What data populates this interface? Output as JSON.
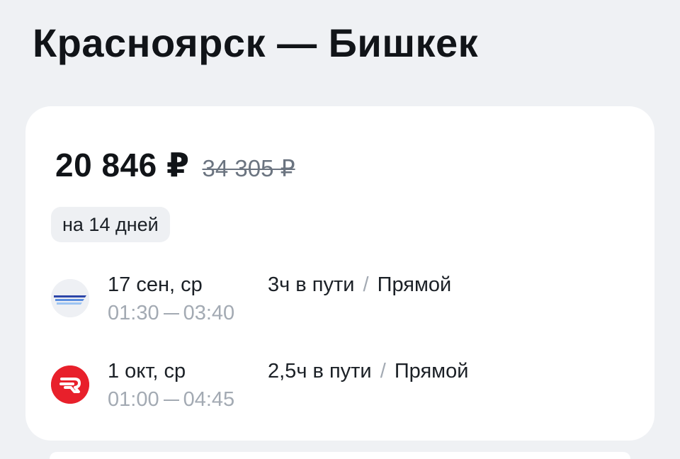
{
  "header": {
    "title": "Красноярск — Бишкек"
  },
  "offer": {
    "price": "20 846 ₽",
    "old_price": "34 305 ₽",
    "trip_length": "на 14 дней"
  },
  "segments": [
    {
      "airline_icon": "airline-stripes-logo",
      "date": "17 сен, ср",
      "depart": "01:30",
      "arrive": "03:40",
      "duration": "3ч в пути",
      "separator": "/",
      "type": "Прямой"
    },
    {
      "airline_icon": "airline-red-circle-logo",
      "date": "1 окт, ср",
      "depart": "01:00",
      "arrive": "04:45",
      "duration": "2,5ч в пути",
      "separator": "/",
      "type": "Прямой"
    }
  ],
  "colors": {
    "background": "#eff1f4",
    "card": "#ffffff",
    "muted_text": "#a3aab3",
    "strikethrough_price": "#6b7480",
    "airline_red": "#e8202b",
    "airline_blue": "#2c45a8"
  }
}
